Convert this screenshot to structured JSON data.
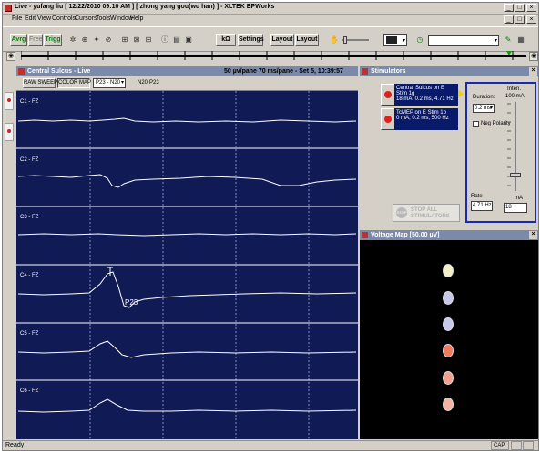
{
  "window": {
    "title": "Live - yufang liu  [ 12/22/2010 09:10 AM ]  [ zhong yang gou(wu han) ]  - XLTEK EPWorks"
  },
  "menu": [
    "File",
    "Edit",
    "View",
    "Controls",
    "Cursors",
    "Tools",
    "Window",
    "Help"
  ],
  "toolbar": {
    "avg": "Avrg",
    "free": "Free",
    "trigg": "Trigg",
    "impedance": "kΩ",
    "settings": "Settings",
    "layout1": "Layout",
    "layout2": "Layout"
  },
  "live_panel": {
    "title": "Central Sulcus - Live",
    "scale": "50 µv/pane 70 ms/pane - Set 5, 10:39:57",
    "raw_sweeps": "RAW SWEEPS",
    "color_map": "COLOR MAP",
    "select_value": "P23 - N20",
    "label_n20": "N20",
    "label_p23": "P23",
    "traces": [
      {
        "label": "C1 - FZ"
      },
      {
        "label": "C2 - FZ"
      },
      {
        "label": "C3 - FZ"
      },
      {
        "label": "C4 - FZ"
      },
      {
        "label": "C5 - FZ"
      },
      {
        "label": "C6 - FZ"
      }
    ],
    "peak_label": "P23"
  },
  "stimulators": {
    "title": "Stimulators",
    "items": [
      {
        "name": "Central Sulcus on E Stim 1g",
        "params": "18 mA, 0.2 ms, 4.71 Hz"
      },
      {
        "name": "TcMEP on E Stim 1b",
        "params": "0 mA, 0.2 ms, 500 Hz"
      }
    ],
    "stop_all": "STOP ALL STIMULATORS",
    "duration_label": "Duration:",
    "duration_value": "0.2 ms",
    "neg_polarity": "Neg Polarity",
    "rate_label": "Rate",
    "rate_value": "4.71 Hz",
    "inten_label": "Inten.",
    "inten_max": "100 mA",
    "inten_unit": "mA",
    "inten_value": "18"
  },
  "voltage_map": {
    "title": "Voltage Map [50.00 µV]",
    "dots": [
      {
        "color": "#f3efc8"
      },
      {
        "color": "#c8c8ec"
      },
      {
        "color": "#c8c8ec"
      },
      {
        "color": "#f07a60"
      },
      {
        "color": "#f4a090"
      },
      {
        "color": "#f4b4a4"
      }
    ]
  },
  "status": {
    "ready": "Ready",
    "cap": "CAP"
  }
}
